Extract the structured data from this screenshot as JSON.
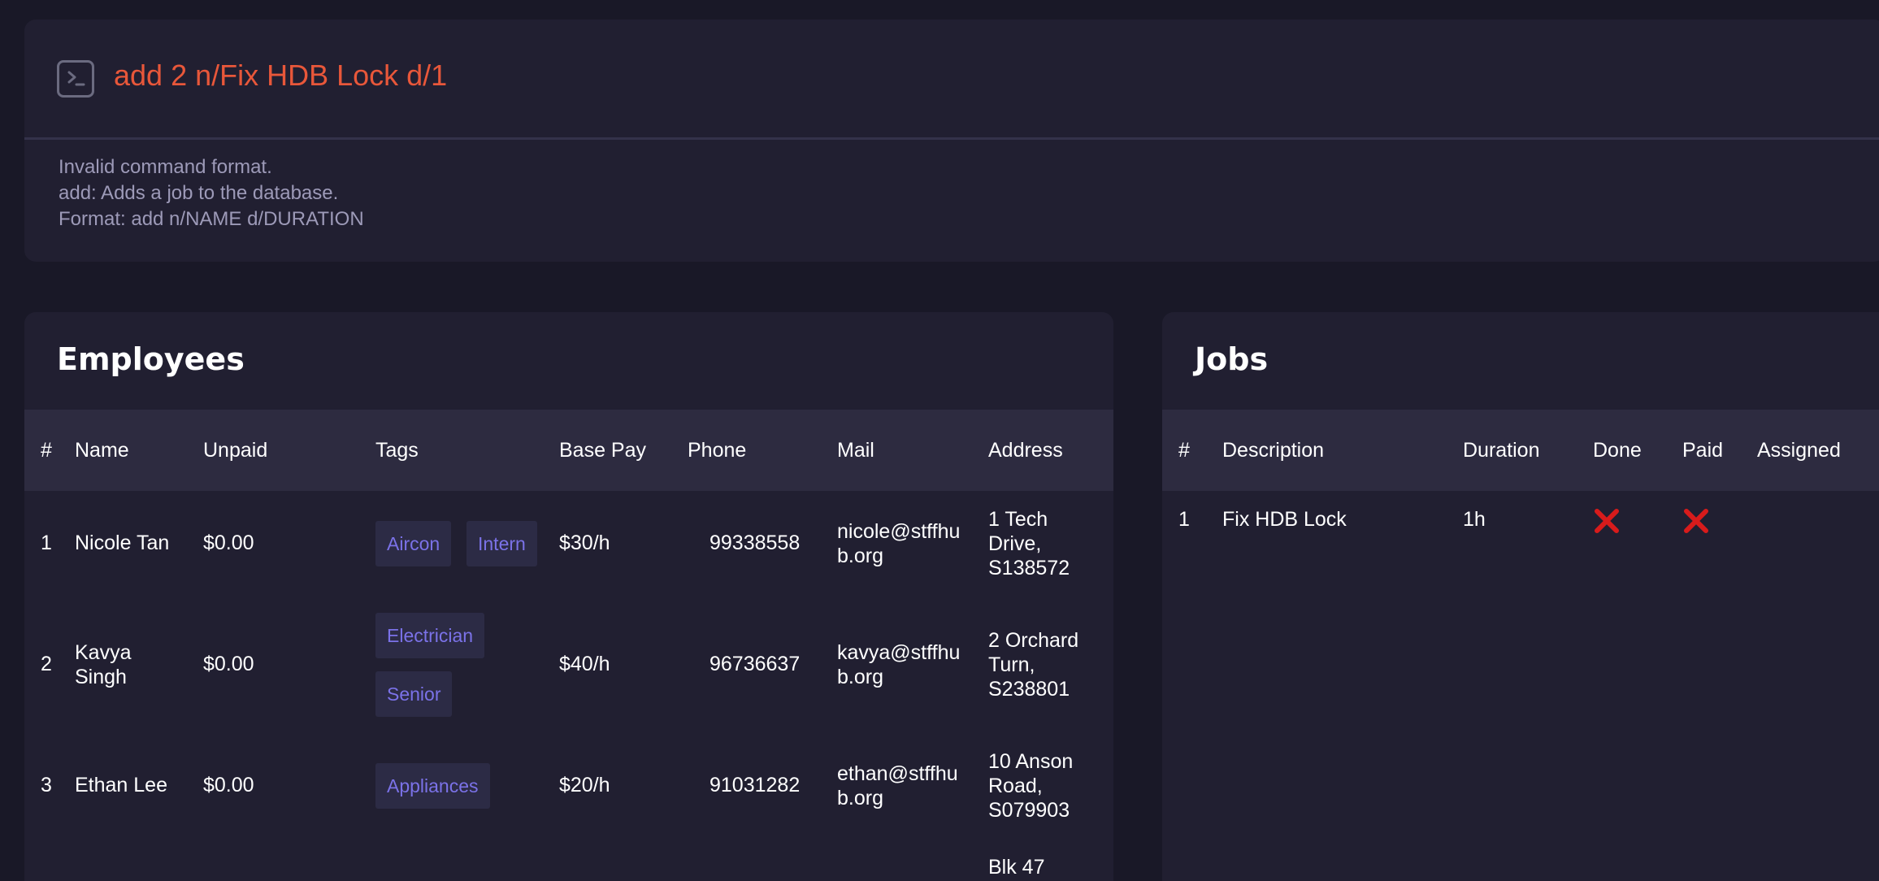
{
  "command": {
    "icon": "terminal-icon",
    "text": "add 2 n/Fix HDB Lock d/1",
    "text_color": "#e8573a"
  },
  "result": {
    "lines": [
      "Invalid command format.",
      "add: Adds a job to the database.",
      "Format: add n/NAME d/DURATION"
    ]
  },
  "employees": {
    "title": "Employees",
    "columns": [
      "#",
      "Name",
      "Unpaid",
      "Tags",
      "Base Pay",
      "Phone",
      "Mail",
      "Address"
    ],
    "rows": [
      {
        "index": "1",
        "name": "Nicole Tan",
        "unpaid": "$0.00",
        "tags": [
          "Aircon",
          "Intern"
        ],
        "base_pay": "$30/h",
        "phone": "99338558",
        "mail": "nicole@stffhub.org",
        "address": "1 Tech Drive, S138572"
      },
      {
        "index": "2",
        "name": "Kavya Singh",
        "unpaid": "$0.00",
        "tags": [
          "Electrician",
          "Senior"
        ],
        "base_pay": "$40/h",
        "phone": "96736637",
        "mail": "kavya@stffhub.org",
        "address": "2 Orchard Turn, S238801"
      },
      {
        "index": "3",
        "name": "Ethan Lee",
        "unpaid": "$0.00",
        "tags": [
          "Appliances"
        ],
        "base_pay": "$20/h",
        "phone": "91031282",
        "mail": "ethan@stffhub.org",
        "address": "10 Anson Road, S079903"
      },
      {
        "index": "",
        "name": "",
        "unpaid": "",
        "tags": [],
        "base_pay": "",
        "phone": "",
        "mail": "",
        "address": "Blk 47"
      }
    ]
  },
  "jobs": {
    "title": "Jobs",
    "columns": [
      "#",
      "Description",
      "Duration",
      "Done",
      "Paid",
      "Assigned"
    ],
    "rows": [
      {
        "index": "1",
        "description": "Fix HDB Lock",
        "duration": "1h",
        "done_icon": "cross-icon",
        "paid_icon": "cross-icon",
        "assigned": ""
      }
    ],
    "cross_color": "#d81b1b"
  },
  "colors": {
    "background": "#191827",
    "panel": "#211f31",
    "header_row": "#2d2b40",
    "tag_bg": "#2c2b45",
    "tag_text": "#7b72e8",
    "muted_text": "#9d9ab8"
  }
}
